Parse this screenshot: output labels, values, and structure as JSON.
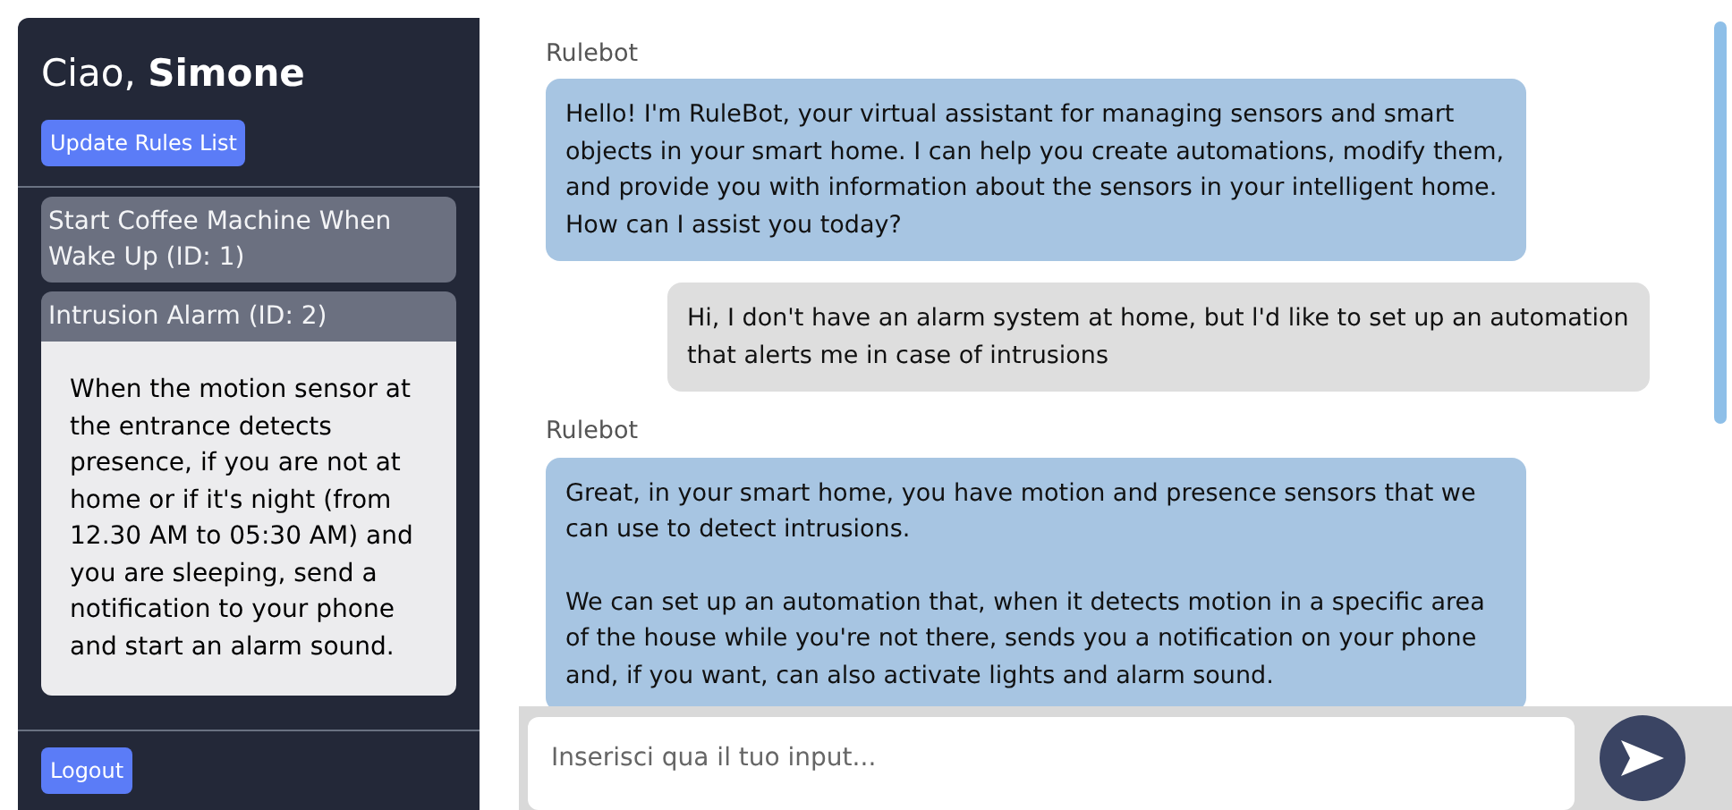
{
  "sidebar": {
    "greeting": "Ciao, **Simone**",
    "update_button": "Update Rules List",
    "rules": [
      {
        "title": "Start Coffee Machine When Wake Up (ID: 1)",
        "expanded": false
      },
      {
        "title": "Intrusion Alarm (ID: 2)",
        "expanded": true,
        "description": "When the motion sensor at the entrance detects presence, if you are not at home or if it's night (from 12.30 AM to 05:30 AM) and you are sleeping, send a notification to your phone and start an alarm sound."
      }
    ],
    "logout_button": "Logout"
  },
  "chat": {
    "messages": [
      {
        "kind": "bot",
        "sender": "Rulebot",
        "paragraphs": [
          "Hello! I'm RuleBot, your virtual assistant for managing sensors and smart objects in your smart home. I can help you create automations, modify them, and provide you with information about the sensors in your intelligent home. How can I assist you today?"
        ]
      },
      {
        "kind": "user",
        "paragraphs": [
          "Hi, I don't have an alarm system at home, but l'd like to set up an automation that alerts me in case of intrusions"
        ]
      },
      {
        "kind": "bot",
        "sender": "Rulebot",
        "paragraphs": [
          "Great, in your smart home, you have motion and presence sensors that we can use to detect intrusions.",
          "We can set up an automation that, when it detects motion in a specific area of the house while you're not there, sends you a notification on your phone and, if you want, can also activate lights and alarm sound."
        ]
      }
    ],
    "input": {
      "placeholder": "Inserisci qua il tuo input..."
    }
  }
}
